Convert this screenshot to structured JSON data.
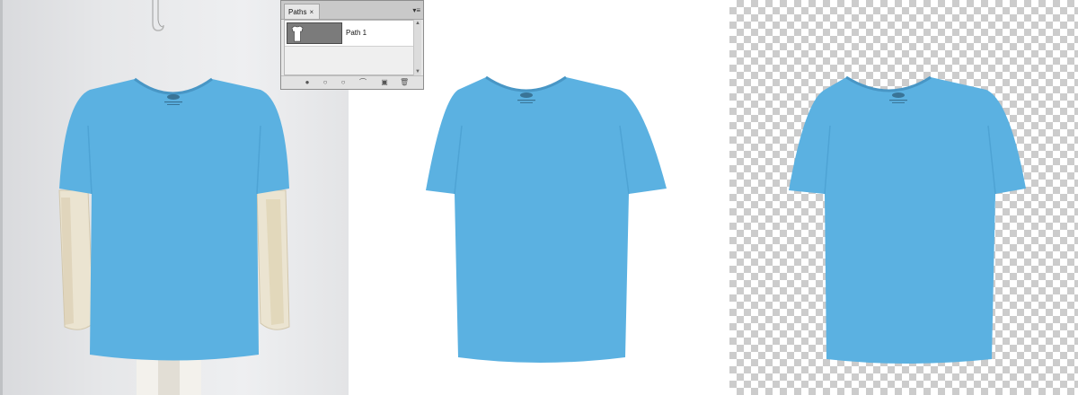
{
  "paths_panel": {
    "tab_label": "Paths",
    "close_glyph": "×",
    "menu_glyph": "▾≡",
    "items": [
      {
        "name": "Path 1",
        "thumbnail_icon": "tshirt-icon"
      }
    ],
    "scroll_up_glyph": "▲",
    "scroll_down_glyph": "▼",
    "footer_icons": [
      "fill-path-icon",
      "stroke-path-icon",
      "load-as-selection-icon",
      "make-work-path-icon",
      "new-path-icon",
      "delete-path-icon"
    ],
    "footer_glyphs": [
      "●",
      "○",
      "○",
      "⌒",
      "▣",
      "🗑"
    ]
  },
  "panels": [
    {
      "name": "original-photo",
      "background": "light-gray"
    },
    {
      "name": "white-background-result",
      "background": "#ffffff"
    },
    {
      "name": "transparent-background-result",
      "background": "checkerboard"
    }
  ],
  "colors": {
    "shirt": "#5bb1e1",
    "shirt_shade": "#4ea3d4",
    "mannequin": "#ece5d3",
    "checker_light": "#ffffff",
    "checker_dark": "#cccccc"
  }
}
